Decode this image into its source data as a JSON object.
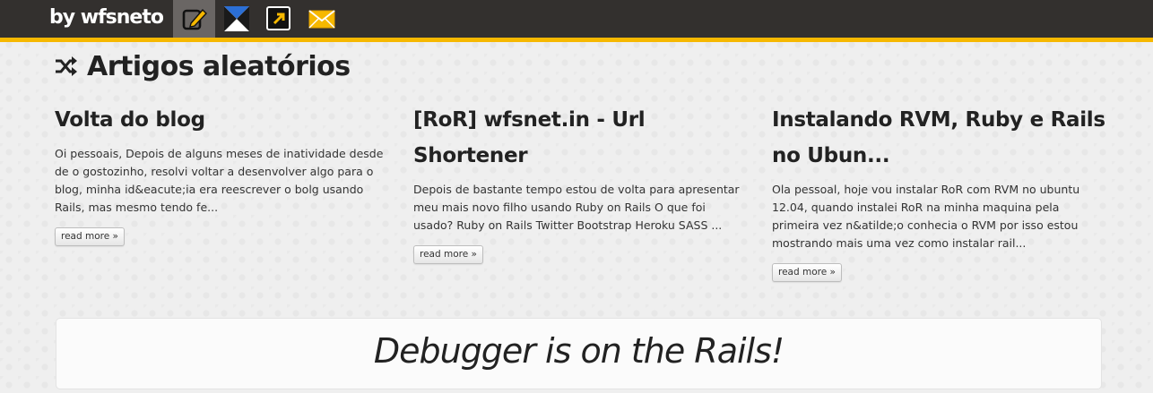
{
  "topbar": {
    "brand": "by wfsneto",
    "nav": [
      {
        "icon": "notepad-pencil-icon",
        "active": true
      },
      {
        "icon": "hourglass-bowtie-icon",
        "active": false
      },
      {
        "icon": "external-link-arrow-icon",
        "active": false
      },
      {
        "icon": "envelope-icon",
        "active": false
      }
    ],
    "colors": {
      "bar": "#33302e",
      "accent": "#f6b800"
    }
  },
  "section": {
    "icon": "shuffle-icon",
    "title": "Artigos aleatórios"
  },
  "articles": [
    {
      "title": "Volta do blog",
      "excerpt": "Oi pessoais, Depois de alguns meses de inatividade desde de o gostozinho, resolvi voltar a desenvolver algo para o blog, minha id&eacute;ia era reescrever o bolg usando Rails, mas mesmo tendo fe...",
      "read_more": "read more »"
    },
    {
      "title": "[RoR] wfsnet.in - Url Shortener",
      "excerpt": "Depois de bastante tempo estou de volta para apresentar meu mais novo filho usando Ruby on Rails O que foi usado? Ruby on Rails Twitter Bootstrap Heroku SASS ...",
      "read_more": "read more »"
    },
    {
      "title": "Instalando RVM, Ruby e Rails no Ubun...",
      "excerpt": "Ola pessoal, hoje vou instalar RoR com RVM no ubuntu 12.04, quando instalei RoR na minha maquina pela primeira vez n&atilde;o conhecia o RVM por isso estou mostrando mais uma vez como instalar rail...",
      "read_more": "read more »"
    }
  ],
  "hero": {
    "text": "Debugger is on the Rails!"
  }
}
